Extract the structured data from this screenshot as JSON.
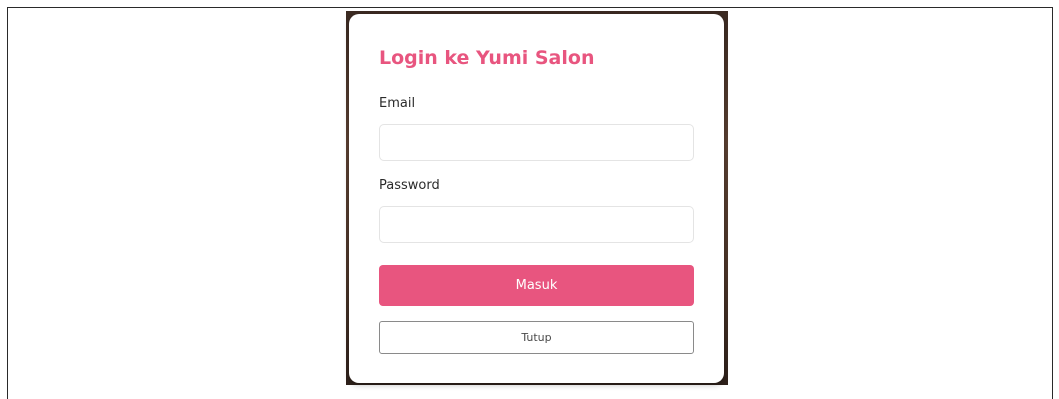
{
  "login_modal": {
    "title": "Login ke Yumi Salon",
    "email_label": "Email",
    "email_value": "",
    "email_placeholder": "",
    "password_label": "Password",
    "password_value": "",
    "password_placeholder": "",
    "submit_label": "Masuk",
    "close_label": "Tutup"
  },
  "colors": {
    "accent": "#e8557f",
    "backdrop": "#4a3428"
  }
}
